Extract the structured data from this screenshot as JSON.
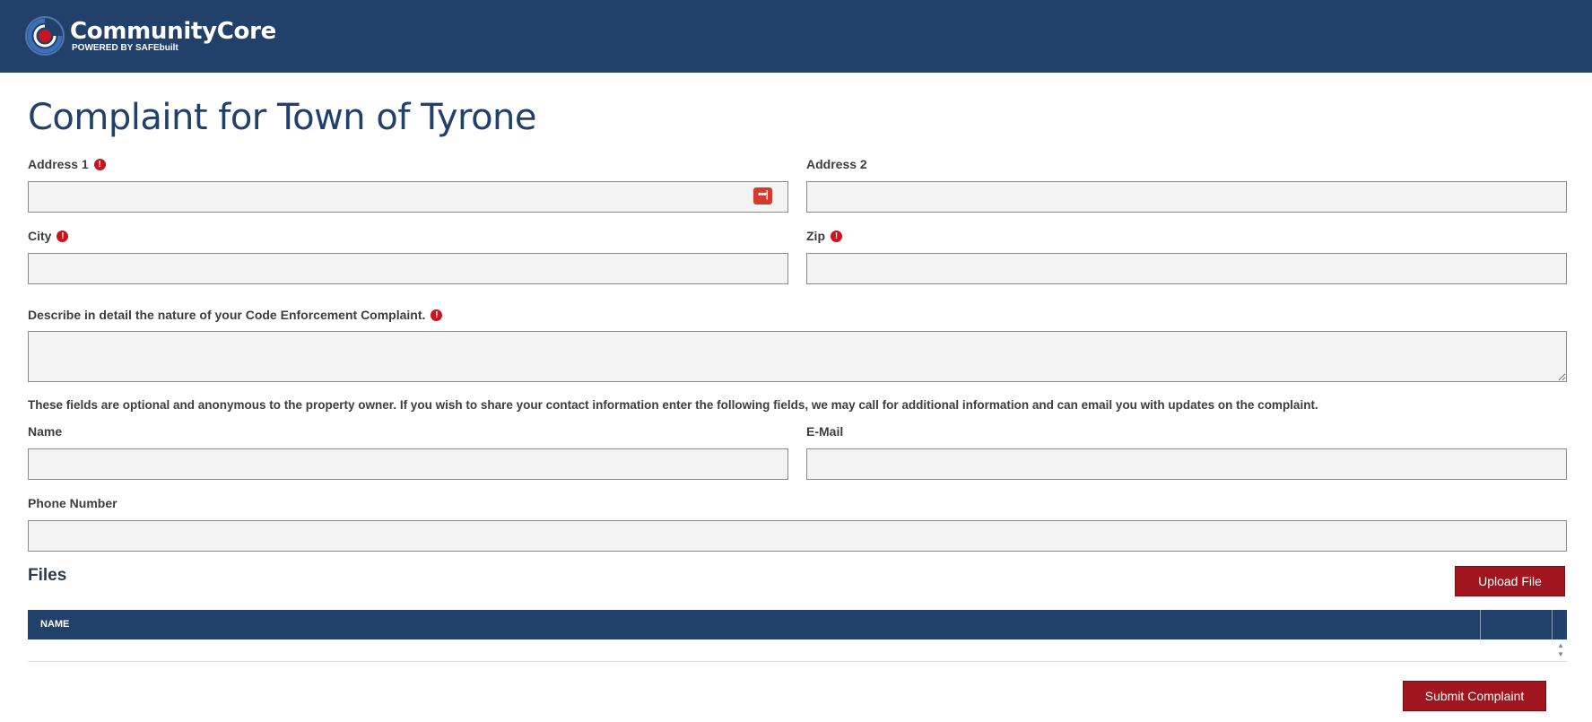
{
  "header": {
    "brand_name": "CommunityCore",
    "brand_sub": "POWERED BY SAFEbuilt",
    "colors": {
      "header_bg": "#21406a",
      "accent_red": "#a1151e"
    }
  },
  "page": {
    "title": "Complaint for Town of Tyrone"
  },
  "form": {
    "address1": {
      "label": "Address 1",
      "value": "",
      "required": true,
      "icon": "password-manager-icon"
    },
    "address2": {
      "label": "Address 2",
      "value": ""
    },
    "city": {
      "label": "City",
      "value": "",
      "required": true
    },
    "zip": {
      "label": "Zip",
      "value": "",
      "required": true
    },
    "description": {
      "label": "Describe in detail the nature of your Code Enforcement Complaint.",
      "value": "",
      "required": true
    },
    "optional_info": "These fields are optional and anonymous to the property owner. If you wish to share your contact information enter the following fields, we may call for additional information and can email you with updates on the complaint.",
    "name": {
      "label": "Name",
      "value": ""
    },
    "email": {
      "label": "E-Mail",
      "value": ""
    },
    "phone": {
      "label": "Phone Number",
      "value": ""
    },
    "required_mark": "!"
  },
  "files": {
    "title": "Files",
    "upload_label": "Upload File",
    "columns": [
      "NAME",
      "",
      ""
    ],
    "rows": []
  },
  "actions": {
    "submit_label": "Submit Complaint"
  }
}
